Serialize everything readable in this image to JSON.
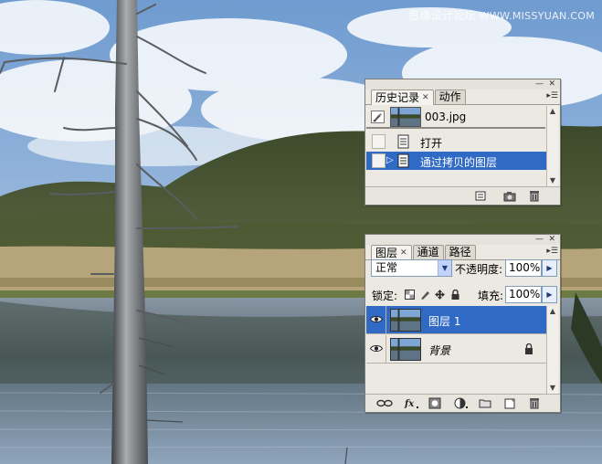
{
  "watermark": {
    "cn": "思缘设计论坛",
    "url": "WWW.MISSYUAN.COM"
  },
  "history_palette": {
    "tabs": [
      {
        "label": "历史记录",
        "active": true,
        "closable": true
      },
      {
        "label": "动作",
        "active": false,
        "closable": false
      }
    ],
    "snapshot": {
      "name": "003.jpg"
    },
    "states": [
      {
        "label": "打开",
        "selected": false
      },
      {
        "label": "通过拷贝的图层",
        "selected": true
      }
    ],
    "bottom_icons": [
      "new-document-from-state-icon",
      "new-snapshot-icon",
      "delete-state-icon"
    ]
  },
  "layers_palette": {
    "tabs": [
      {
        "label": "图层",
        "active": true,
        "closable": true
      },
      {
        "label": "通道",
        "active": false
      },
      {
        "label": "路径",
        "active": false
      }
    ],
    "blend_mode": "正常",
    "opacity_label": "不透明度:",
    "opacity_value": "100%",
    "lock_label": "锁定:",
    "fill_label": "填充:",
    "fill_value": "100%",
    "layers": [
      {
        "name": "图层 1",
        "visible": true,
        "selected": true,
        "locked": false,
        "italic": false
      },
      {
        "name": "背景",
        "visible": true,
        "selected": false,
        "locked": true,
        "italic": true
      }
    ],
    "bottom_icons": [
      "link-layers-icon",
      "layer-style-icon",
      "layer-mask-icon",
      "adjustment-layer-icon",
      "new-group-icon",
      "new-layer-icon",
      "delete-layer-icon"
    ]
  },
  "colors": {
    "selection": "#316ac5",
    "panel": "#ebe9e1",
    "lake": "#5f7386",
    "sky": "#7ea6d5"
  }
}
